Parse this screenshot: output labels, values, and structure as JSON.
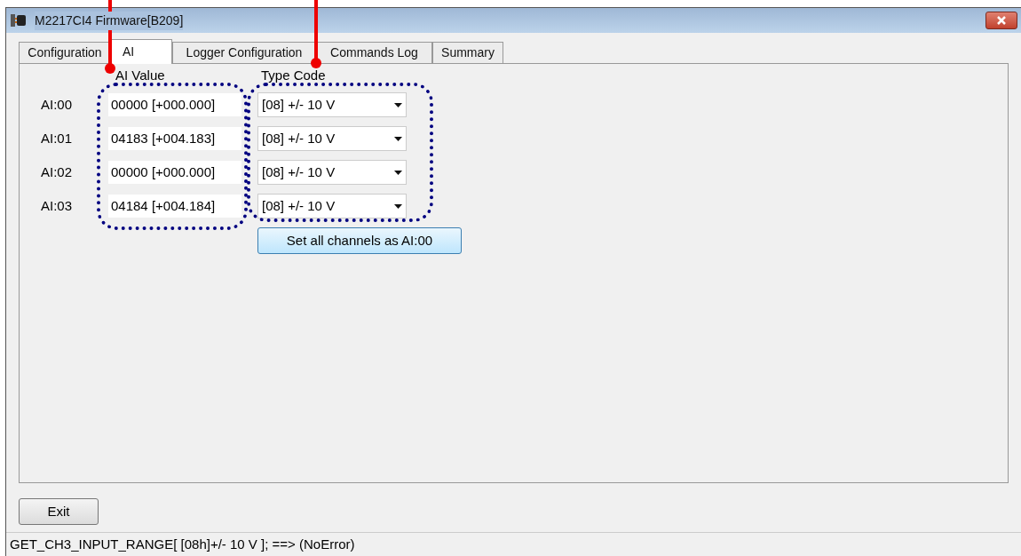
{
  "window": {
    "title": "M2217CI4 Firmware[B209]"
  },
  "tabs": [
    {
      "label": "Configuration",
      "selected": false
    },
    {
      "label": "AI",
      "selected": true
    },
    {
      "label": "Logger Configuration",
      "selected": false
    },
    {
      "label": "Commands Log",
      "selected": false
    },
    {
      "label": "Summary",
      "selected": false
    }
  ],
  "columns": [
    "AI Value",
    "Type Code"
  ],
  "channels": [
    {
      "label": "AI:00",
      "value": "00000 [+000.000]",
      "type_code": "[08] +/- 10 V"
    },
    {
      "label": "AI:01",
      "value": "04183 [+004.183]",
      "type_code": "[08] +/- 10 V"
    },
    {
      "label": "AI:02",
      "value": "00000 [+000.000]",
      "type_code": "[08] +/- 10 V"
    },
    {
      "label": "AI:03",
      "value": "04184 [+004.184]",
      "type_code": "[08] +/- 10 V"
    }
  ],
  "set_all_button": "Set all channels as AI:00",
  "exit_button": "Exit",
  "status_bar": "GET_CH3_INPUT_RANGE[ [08h]+/- 10 V ]; ==> (NoError)"
}
